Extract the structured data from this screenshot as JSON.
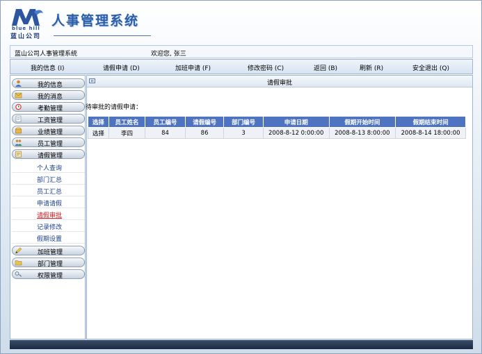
{
  "header": {
    "logo_en": "blue hill",
    "logo_cn": "蓝山公司",
    "app_title": "人事管理系统"
  },
  "infobar": {
    "system_name": "蓝山公司人事管理系统",
    "welcome": "欢迎您, 张三"
  },
  "nav": {
    "items": [
      {
        "label": "我的信息 (I)"
      },
      {
        "label": "请假申请 (D)"
      },
      {
        "label": "加班申请 (F)"
      },
      {
        "label": "修改密码 (C)"
      },
      {
        "label": "返回 (B)"
      },
      {
        "label": "刷新 (R)"
      },
      {
        "label": "安全退出 (Q)"
      }
    ]
  },
  "sidebar": {
    "groups_top": [
      {
        "label": "我的信息",
        "icon": "person-icon"
      },
      {
        "label": "我的消息",
        "icon": "message-icon"
      },
      {
        "label": "考勤管理",
        "icon": "clock-icon"
      },
      {
        "label": "工资管理",
        "icon": "document-icon"
      },
      {
        "label": "业绩管理",
        "icon": "box-icon"
      },
      {
        "label": "员工管理",
        "icon": "people-icon"
      },
      {
        "label": "请假管理",
        "icon": "leave-icon"
      }
    ],
    "sub_items": [
      {
        "label": "个人查询"
      },
      {
        "label": "部门汇总"
      },
      {
        "label": "员工汇总"
      },
      {
        "label": "申请请假"
      },
      {
        "label": "请假审批"
      },
      {
        "label": "记录修改"
      },
      {
        "label": "假期设置"
      }
    ],
    "groups_bottom": [
      {
        "label": "加班管理",
        "icon": "pencil-icon"
      },
      {
        "label": "部门管理",
        "icon": "folder-icon"
      },
      {
        "label": "权限管理",
        "icon": "key-icon"
      }
    ]
  },
  "main": {
    "title": "请假审批",
    "pending_label": "待审批的请假申请：",
    "table": {
      "headers": [
        "选择",
        "员工姓名",
        "员工编号",
        "请假编号",
        "部门编号",
        "申请日期",
        "假期开始时间",
        "假期结束时间"
      ],
      "rows": [
        [
          "选择",
          "李四",
          "84",
          "86",
          "3",
          "2008-8-12 0:00:00",
          "2008-8-13 8:00:00",
          "2008-8-14 18:00:00"
        ]
      ]
    }
  },
  "colors": {
    "accent": "#4e74c1",
    "title": "#2a5ea8",
    "active_link": "#d0191b"
  }
}
